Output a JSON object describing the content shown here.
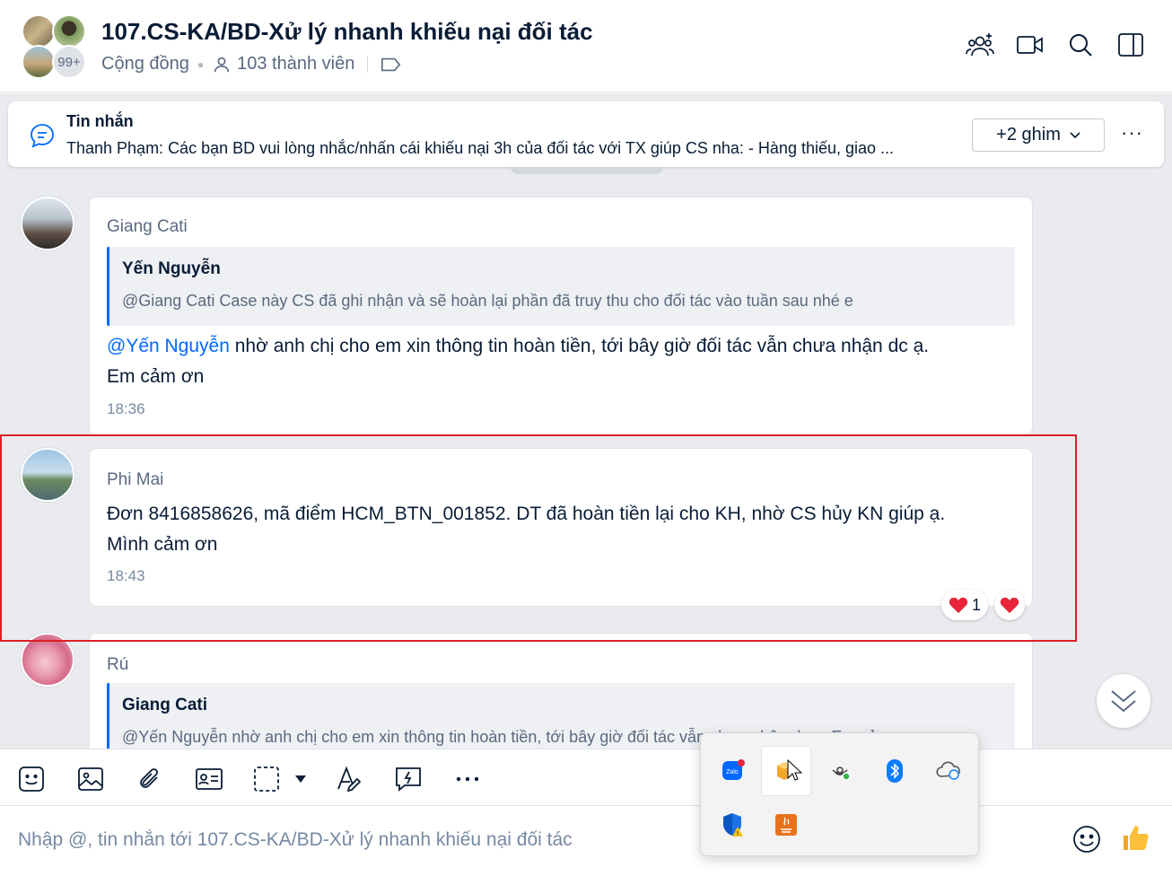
{
  "header": {
    "title": "107.CS-KA/BD-Xử lý nhanh khiếu nại đối tác",
    "type": "Cộng đồng",
    "members": "103 thành viên",
    "avatar_overflow": "99+",
    "icons": [
      "add-member-icon",
      "video-call-icon",
      "search-icon",
      "sidebar-toggle-icon"
    ]
  },
  "pinned": {
    "label": "Tin nhắn",
    "text": "Thanh Phạm: Các bạn BD vui lòng nhắc/nhấn cái khiếu nại 3h của đối tác với TX giúp CS nha: - Hàng thiếu, giao ...",
    "more_pins": "+2 ghim",
    "more_label": "···"
  },
  "messages": [
    {
      "sender": "Giang Cati",
      "quote_name": "Yến Nguyễn",
      "quote_text": "@Giang Cati Case này CS đã ghi nhận và sẽ hoàn lại phần đã truy thu cho đối tác vào tuần sau nhé e",
      "mention": "@Yến Nguyễn",
      "text_line1": " nhờ anh chị cho em xin thông tin hoàn tiền, tới bây giờ đối tác vẫn chưa nhận dc ạ.",
      "text_line2": "Em cảm ơn",
      "time": "18:36"
    },
    {
      "sender": "Phi Mai",
      "text_line1": "Đơn 8416858626, mã điểm HCM_BTN_001852. DT đã hoàn tiền lại cho KH, nhờ CS hủy KN giúp ạ.",
      "text_line2": "Mình cảm ơn",
      "time": "18:43",
      "reaction_count": "1"
    },
    {
      "sender": "Rú",
      "quote_name": "Giang Cati",
      "quote_text": "@Yến Nguyễn nhờ anh chị cho em xin thông tin hoàn tiền, tới bây giờ đối tác vẫn chưa nhận dc ạ. Em cảm ơn"
    }
  ],
  "composer": {
    "placeholder": "Nhập @, tin nhắn tới 107.CS-KA/BD-Xử lý nhanh khiếu nại đối tác",
    "toolbar_icons": [
      "sticker-icon",
      "image-icon",
      "attach-icon",
      "contact-card-icon",
      "screenshot-icon",
      "format-text-icon",
      "quick-message-icon",
      "more-icon"
    ]
  },
  "tray": {
    "icons": [
      "zalo-icon",
      "app-icon",
      "hotspot-icon",
      "bluetooth-icon",
      "onedrive-icon",
      "defender-icon",
      "java-icon"
    ]
  },
  "colors": {
    "accent": "#0068ff",
    "highlight": "#d9202a",
    "chat_bg": "#e9ebee"
  }
}
